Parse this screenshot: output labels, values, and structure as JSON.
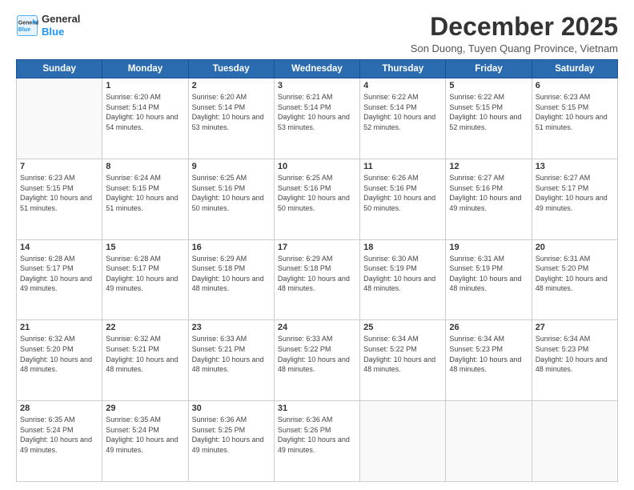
{
  "logo": {
    "line1": "General",
    "line2": "Blue"
  },
  "title": "December 2025",
  "subtitle": "Son Duong, Tuyen Quang Province, Vietnam",
  "days_of_week": [
    "Sunday",
    "Monday",
    "Tuesday",
    "Wednesday",
    "Thursday",
    "Friday",
    "Saturday"
  ],
  "weeks": [
    [
      {
        "day": "",
        "info": ""
      },
      {
        "day": "1",
        "sunrise": "6:20 AM",
        "sunset": "5:14 PM",
        "daylight": "10 hours and 54 minutes."
      },
      {
        "day": "2",
        "sunrise": "6:20 AM",
        "sunset": "5:14 PM",
        "daylight": "10 hours and 53 minutes."
      },
      {
        "day": "3",
        "sunrise": "6:21 AM",
        "sunset": "5:14 PM",
        "daylight": "10 hours and 53 minutes."
      },
      {
        "day": "4",
        "sunrise": "6:22 AM",
        "sunset": "5:14 PM",
        "daylight": "10 hours and 52 minutes."
      },
      {
        "day": "5",
        "sunrise": "6:22 AM",
        "sunset": "5:15 PM",
        "daylight": "10 hours and 52 minutes."
      },
      {
        "day": "6",
        "sunrise": "6:23 AM",
        "sunset": "5:15 PM",
        "daylight": "10 hours and 51 minutes."
      }
    ],
    [
      {
        "day": "7",
        "sunrise": "6:23 AM",
        "sunset": "5:15 PM",
        "daylight": "10 hours and 51 minutes."
      },
      {
        "day": "8",
        "sunrise": "6:24 AM",
        "sunset": "5:15 PM",
        "daylight": "10 hours and 51 minutes."
      },
      {
        "day": "9",
        "sunrise": "6:25 AM",
        "sunset": "5:16 PM",
        "daylight": "10 hours and 50 minutes."
      },
      {
        "day": "10",
        "sunrise": "6:25 AM",
        "sunset": "5:16 PM",
        "daylight": "10 hours and 50 minutes."
      },
      {
        "day": "11",
        "sunrise": "6:26 AM",
        "sunset": "5:16 PM",
        "daylight": "10 hours and 50 minutes."
      },
      {
        "day": "12",
        "sunrise": "6:27 AM",
        "sunset": "5:16 PM",
        "daylight": "10 hours and 49 minutes."
      },
      {
        "day": "13",
        "sunrise": "6:27 AM",
        "sunset": "5:17 PM",
        "daylight": "10 hours and 49 minutes."
      }
    ],
    [
      {
        "day": "14",
        "sunrise": "6:28 AM",
        "sunset": "5:17 PM",
        "daylight": "10 hours and 49 minutes."
      },
      {
        "day": "15",
        "sunrise": "6:28 AM",
        "sunset": "5:17 PM",
        "daylight": "10 hours and 49 minutes."
      },
      {
        "day": "16",
        "sunrise": "6:29 AM",
        "sunset": "5:18 PM",
        "daylight": "10 hours and 48 minutes."
      },
      {
        "day": "17",
        "sunrise": "6:29 AM",
        "sunset": "5:18 PM",
        "daylight": "10 hours and 48 minutes."
      },
      {
        "day": "18",
        "sunrise": "6:30 AM",
        "sunset": "5:19 PM",
        "daylight": "10 hours and 48 minutes."
      },
      {
        "day": "19",
        "sunrise": "6:31 AM",
        "sunset": "5:19 PM",
        "daylight": "10 hours and 48 minutes."
      },
      {
        "day": "20",
        "sunrise": "6:31 AM",
        "sunset": "5:20 PM",
        "daylight": "10 hours and 48 minutes."
      }
    ],
    [
      {
        "day": "21",
        "sunrise": "6:32 AM",
        "sunset": "5:20 PM",
        "daylight": "10 hours and 48 minutes."
      },
      {
        "day": "22",
        "sunrise": "6:32 AM",
        "sunset": "5:21 PM",
        "daylight": "10 hours and 48 minutes."
      },
      {
        "day": "23",
        "sunrise": "6:33 AM",
        "sunset": "5:21 PM",
        "daylight": "10 hours and 48 minutes."
      },
      {
        "day": "24",
        "sunrise": "6:33 AM",
        "sunset": "5:22 PM",
        "daylight": "10 hours and 48 minutes."
      },
      {
        "day": "25",
        "sunrise": "6:34 AM",
        "sunset": "5:22 PM",
        "daylight": "10 hours and 48 minutes."
      },
      {
        "day": "26",
        "sunrise": "6:34 AM",
        "sunset": "5:23 PM",
        "daylight": "10 hours and 48 minutes."
      },
      {
        "day": "27",
        "sunrise": "6:34 AM",
        "sunset": "5:23 PM",
        "daylight": "10 hours and 48 minutes."
      }
    ],
    [
      {
        "day": "28",
        "sunrise": "6:35 AM",
        "sunset": "5:24 PM",
        "daylight": "10 hours and 49 minutes."
      },
      {
        "day": "29",
        "sunrise": "6:35 AM",
        "sunset": "5:24 PM",
        "daylight": "10 hours and 49 minutes."
      },
      {
        "day": "30",
        "sunrise": "6:36 AM",
        "sunset": "5:25 PM",
        "daylight": "10 hours and 49 minutes."
      },
      {
        "day": "31",
        "sunrise": "6:36 AM",
        "sunset": "5:26 PM",
        "daylight": "10 hours and 49 minutes."
      },
      {
        "day": "",
        "info": ""
      },
      {
        "day": "",
        "info": ""
      },
      {
        "day": "",
        "info": ""
      }
    ]
  ]
}
